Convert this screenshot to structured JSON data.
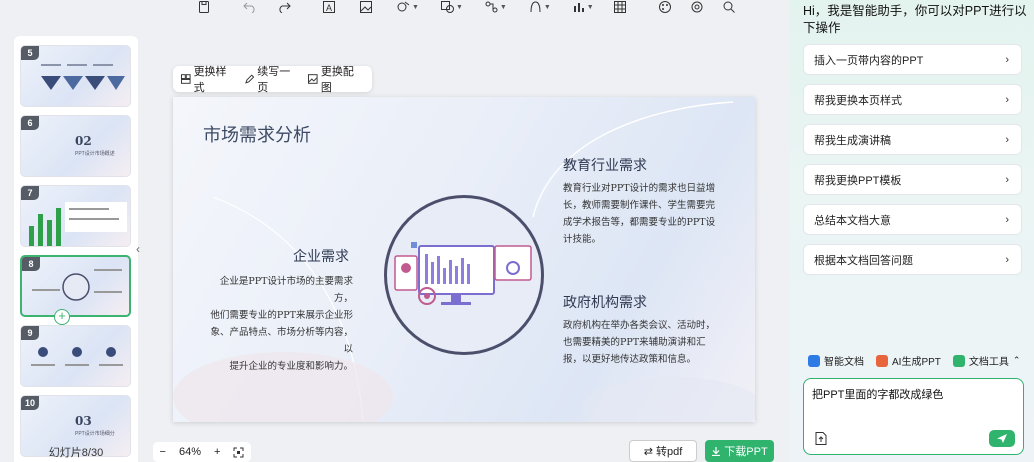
{
  "toolbar": {
    "icons": [
      "save-icon",
      "undo-icon",
      "redo-icon",
      "textbox-icon",
      "image-icon",
      "shape-icon",
      "format-icon",
      "smartart-icon",
      "formula-icon",
      "chart-icon",
      "table-icon",
      "theme-icon",
      "settings-icon",
      "search-icon"
    ]
  },
  "thumbnails": [
    {
      "num": "5",
      "big": "",
      "small": ""
    },
    {
      "num": "6",
      "big": "02",
      "small": "PPT设计市场概述"
    },
    {
      "num": "7",
      "big": "",
      "small": ""
    },
    {
      "num": "8",
      "big": "",
      "small": ""
    },
    {
      "num": "9",
      "big": "",
      "small": ""
    },
    {
      "num": "10",
      "big": "03",
      "small": "PPT设计市场细分"
    }
  ],
  "slide_counter": "幻灯片8/30",
  "ai_tools": {
    "change_style": "更换样式",
    "continue_write": "续写一页",
    "change_image": "更换配图"
  },
  "slide": {
    "title": "市场需求分析",
    "enterprise": {
      "heading": "企业需求",
      "lines": [
        "企业是PPT设计市场的主要需求方，",
        "他们需要专业的PPT来展示企业形",
        "象、产品特点、市场分析等内容，以",
        "提升企业的专业度和影响力。"
      ]
    },
    "education": {
      "heading": "教育行业需求",
      "lines": [
        "教育行业对PPT设计的需求也日益增",
        "长，教师需要制作课件、学生需要完",
        "成学术报告等，都需要专业的PPT设",
        "计技能。"
      ]
    },
    "government": {
      "heading": "政府机构需求",
      "lines": [
        "政府机构在举办各类会议、活动时，",
        "也需要精美的PPT来辅助演讲和汇",
        "报，以更好地传达政策和信息。"
      ]
    }
  },
  "zoom": {
    "minus": "−",
    "level": "64%",
    "plus": "+"
  },
  "buttons": {
    "to_pdf": "转pdf",
    "download": "下载PPT"
  },
  "assistant": {
    "greeting": "Hi，我是智能助手，你可以对PPT进行以下操作",
    "suggestions": [
      "插入一页带内容的PPT",
      "帮我更换本页样式",
      "帮我生成演讲稿",
      "帮我更换PPT模板",
      "总结本文档大意",
      "根据本文档回答问题"
    ],
    "tools": [
      "智能文档",
      "AI生成PPT",
      "文档工具"
    ],
    "input_value": "把PPT里面的字都改成绿色"
  },
  "colors": {
    "accent": "#2fb36d",
    "slide_text": "#2f3a52"
  }
}
